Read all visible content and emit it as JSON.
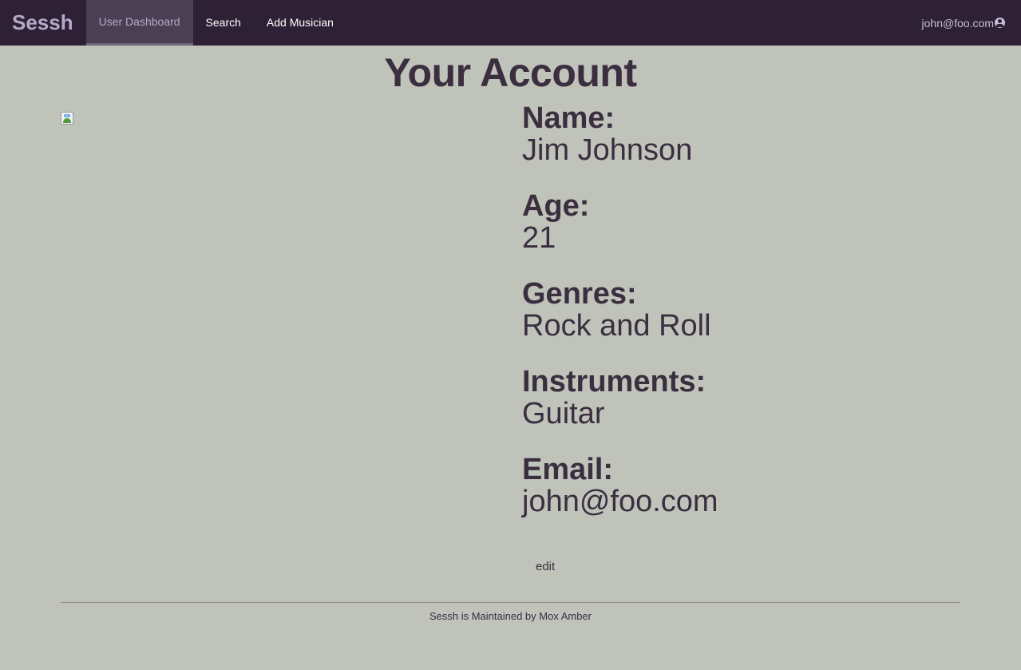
{
  "nav": {
    "brand": "Sessh",
    "links": [
      {
        "label": "User Dashboard",
        "active": true
      },
      {
        "label": "Search",
        "active": false
      },
      {
        "label": "Add Musician",
        "active": false
      }
    ],
    "user_email": "john@foo.com",
    "user_icon": "user-circle-icon"
  },
  "main": {
    "title": "Your Account",
    "fields": [
      {
        "label": "Name:",
        "value": "Jim Johnson"
      },
      {
        "label": "Age:",
        "value": "21"
      },
      {
        "label": "Genres:",
        "value": "Rock and Roll"
      },
      {
        "label": "Instruments:",
        "value": "Guitar"
      },
      {
        "label": "Email:",
        "value": "john@foo.com"
      }
    ],
    "edit_label": "edit"
  },
  "footer": {
    "text": "Sessh is Maintained by Mox Amber"
  },
  "colors": {
    "navbar_bg": "#2e2136",
    "page_bg": "#bfc3ba",
    "text": "#3a2e3f",
    "brand": "#b7a8c9"
  }
}
